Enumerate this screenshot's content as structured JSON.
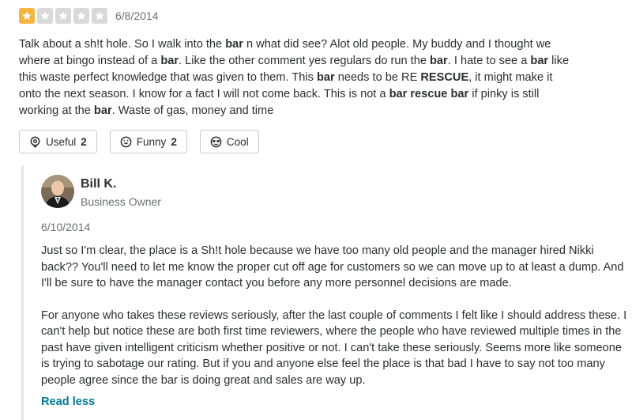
{
  "review": {
    "rating": 1,
    "rating_max": 5,
    "date": "6/8/2014",
    "text_segments": [
      {
        "t": "Talk about a sh!t hole. So I walk into the ",
        "b": false
      },
      {
        "t": "bar",
        "b": true
      },
      {
        "t": " n what did see? Alot old people. My buddy and I thought we where at bingo instead of a ",
        "b": false
      },
      {
        "t": "bar",
        "b": true
      },
      {
        "t": ". Like the other comment yes regulars do run the ",
        "b": false
      },
      {
        "t": "bar",
        "b": true
      },
      {
        "t": ". I hate to see a ",
        "b": false
      },
      {
        "t": "bar",
        "b": true
      },
      {
        "t": " like this waste perfect knowledge that was given to them. This ",
        "b": false
      },
      {
        "t": "bar",
        "b": true
      },
      {
        "t": " needs to be RE ",
        "b": false
      },
      {
        "t": "RESCUE",
        "b": true
      },
      {
        "t": ", it might make it onto the next season. I know for a fact I will not come back. This is not a ",
        "b": false
      },
      {
        "t": "bar rescue bar",
        "b": true
      },
      {
        "t": " if pinky is still working at the ",
        "b": false
      },
      {
        "t": "bar",
        "b": true
      },
      {
        "t": ".  Waste of gas, money and time",
        "b": false
      }
    ]
  },
  "votes": {
    "useful": {
      "label": "Useful",
      "count": "2",
      "icon": "lightbulb-icon"
    },
    "funny": {
      "label": "Funny",
      "count": "2",
      "icon": "smile-icon"
    },
    "cool": {
      "label": "Cool",
      "count": "",
      "icon": "sunglasses-face-icon"
    }
  },
  "owner_reply": {
    "name": "Bill K.",
    "role": "Business Owner",
    "date": "6/10/2014",
    "paragraphs": [
      "Just so I'm clear, the place is a Sh!t hole because we have too many old people and the manager hired Nikki back?? You'll need to let me know the proper cut off age for customers so we can move up to at least a dump. And I'll be sure to have the manager contact you before any more personnel decisions are made.",
      "For anyone who takes these reviews seriously, after the last couple of comments I felt like I should address these. I can't help but notice these are both first time reviewers, where the people who have reviewed multiple times in the past have given intelligent criticism whether positive or not. I can't take these seriously. Seems more like someone is trying to sabotage our rating. But if you and anyone else feel the place is that bad I have to say not too many people agree since the bar is doing great and sales are way up."
    ],
    "read_less_label": "Read less"
  },
  "colors": {
    "star_filled": "#f5b53f",
    "star_empty": "#d9d9d9",
    "link": "#027a97"
  }
}
